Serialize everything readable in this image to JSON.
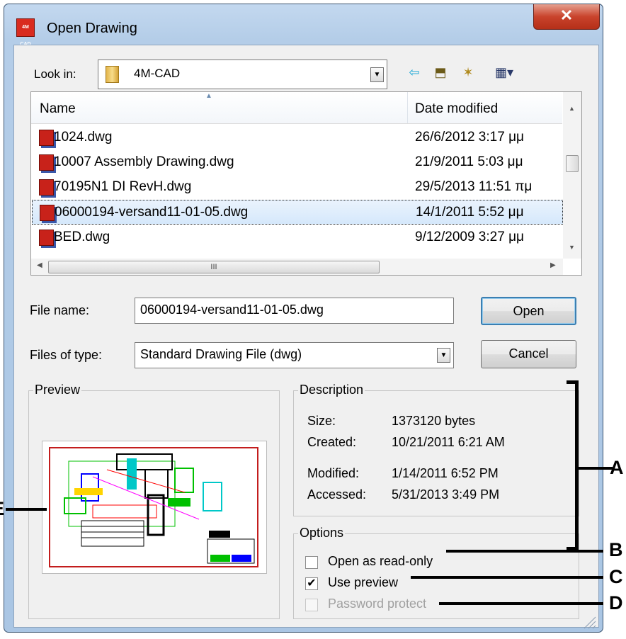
{
  "window": {
    "title": "Open Drawing",
    "app_icon_text": "4M CAD"
  },
  "lookin": {
    "label": "Look in:",
    "value": "4M-CAD"
  },
  "toolbar": {
    "back_glyph": "⇦",
    "up_glyph": "⬒",
    "newfolder_glyph": "✶",
    "views_glyph": "▦▾"
  },
  "filelist": {
    "columns": {
      "name": "Name",
      "date": "Date modified"
    },
    "rows": [
      {
        "name": "1024.dwg",
        "date": "26/6/2012 3:17 μμ"
      },
      {
        "name": "10007 Assembly Drawing.dwg",
        "date": "21/9/2011 5:03 μμ"
      },
      {
        "name": "70195N1 DI RevH.dwg",
        "date": "29/5/2013 11:51 πμ"
      },
      {
        "name": "06000194-versand11-01-05.dwg",
        "date": "14/1/2011 5:52 μμ"
      },
      {
        "name": "BED.dwg",
        "date": "9/12/2009 3:27 μμ"
      }
    ],
    "hscroll_grip": "III"
  },
  "form": {
    "filename_label": "File name:",
    "filename_value": "06000194-versand11-01-05.dwg",
    "filetype_label": "Files of type:",
    "filetype_value": "Standard Drawing File (dwg)",
    "open_label": "Open",
    "cancel_label": "Cancel"
  },
  "preview": {
    "title": "Preview"
  },
  "description": {
    "title": "Description",
    "size_label": "Size:",
    "size_value": "1373120 bytes",
    "created_label": "Created:",
    "created_value": "10/21/2011 6:21 AM",
    "modified_label": "Modified:",
    "modified_value": "1/14/2011 6:52 PM",
    "accessed_label": "Accessed:",
    "accessed_value": "5/31/2013 3:49 PM"
  },
  "options": {
    "title": "Options",
    "readonly_label": "Open as read-only",
    "preview_label": "Use preview",
    "password_label": "Password protect",
    "check_mark": "✔"
  },
  "callouts": {
    "a": "A",
    "b": "B",
    "c": "C",
    "d": "D",
    "e": "E"
  }
}
